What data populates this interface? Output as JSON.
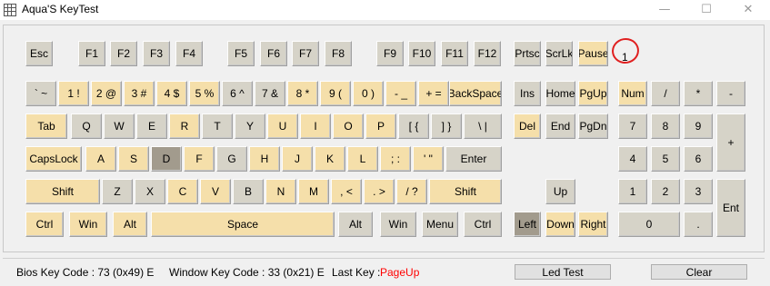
{
  "window": {
    "title": "Aqua'S KeyTest",
    "min_glyph": "—",
    "max_glyph": "☐",
    "close_glyph": "✕"
  },
  "keyboard": {
    "pressed_color": "#f5dfaa",
    "unpressed_color": "#d6d3c8",
    "current_color": "#a29b8d",
    "keys": [
      {
        "label": "Esc",
        "state": "gray"
      },
      {
        "label": "F1",
        "state": "gray"
      },
      {
        "label": "F2",
        "state": "gray"
      },
      {
        "label": "F3",
        "state": "gray"
      },
      {
        "label": "F4",
        "state": "gray"
      },
      {
        "label": "F5",
        "state": "gray"
      },
      {
        "label": "F6",
        "state": "gray"
      },
      {
        "label": "F7",
        "state": "gray"
      },
      {
        "label": "F8",
        "state": "gray"
      },
      {
        "label": "F9",
        "state": "gray"
      },
      {
        "label": "F10",
        "state": "gray"
      },
      {
        "label": "F11",
        "state": "gray"
      },
      {
        "label": "F12",
        "state": "gray"
      },
      {
        "label": "Prtsc",
        "state": "gray"
      },
      {
        "label": "ScrLk",
        "state": "gray"
      },
      {
        "label": "Pause",
        "state": "yellow"
      },
      {
        "label": "` ~",
        "state": "gray"
      },
      {
        "label": "1 !",
        "state": "yellow"
      },
      {
        "label": "2 @",
        "state": "yellow"
      },
      {
        "label": "3 #",
        "state": "yellow"
      },
      {
        "label": "4 $",
        "state": "yellow"
      },
      {
        "label": "5 %",
        "state": "yellow"
      },
      {
        "label": "6 ^",
        "state": "gray"
      },
      {
        "label": "7 &",
        "state": "gray"
      },
      {
        "label": "8 *",
        "state": "yellow"
      },
      {
        "label": "9 (",
        "state": "yellow"
      },
      {
        "label": "0 )",
        "state": "yellow"
      },
      {
        "label": "- _",
        "state": "yellow"
      },
      {
        "label": "+ =",
        "state": "yellow"
      },
      {
        "label": "BackSpace",
        "state": "yellow"
      },
      {
        "label": "Ins",
        "state": "gray"
      },
      {
        "label": "Home",
        "state": "gray"
      },
      {
        "label": "PgUp",
        "state": "yellow"
      },
      {
        "label": "Num",
        "state": "yellow"
      },
      {
        "label": "/",
        "state": "gray"
      },
      {
        "label": "*",
        "state": "gray"
      },
      {
        "label": "-",
        "state": "gray"
      },
      {
        "label": "Tab",
        "state": "yellow"
      },
      {
        "label": "Q",
        "state": "gray"
      },
      {
        "label": "W",
        "state": "gray"
      },
      {
        "label": "E",
        "state": "gray"
      },
      {
        "label": "R",
        "state": "yellow"
      },
      {
        "label": "T",
        "state": "gray"
      },
      {
        "label": "Y",
        "state": "gray"
      },
      {
        "label": "U",
        "state": "yellow"
      },
      {
        "label": "I",
        "state": "yellow"
      },
      {
        "label": "O",
        "state": "yellow"
      },
      {
        "label": "P",
        "state": "yellow"
      },
      {
        "label": "[ {",
        "state": "gray"
      },
      {
        "label": "] }",
        "state": "gray"
      },
      {
        "label": "\\ |",
        "state": "gray"
      },
      {
        "label": "Del",
        "state": "yellow"
      },
      {
        "label": "End",
        "state": "gray"
      },
      {
        "label": "PgDn",
        "state": "gray"
      },
      {
        "label": "7",
        "state": "gray"
      },
      {
        "label": "8",
        "state": "gray"
      },
      {
        "label": "9",
        "state": "gray"
      },
      {
        "label": "+",
        "state": "gray"
      },
      {
        "label": "CapsLock",
        "state": "yellow"
      },
      {
        "label": "A",
        "state": "yellow"
      },
      {
        "label": "S",
        "state": "yellow"
      },
      {
        "label": "D",
        "state": "dark"
      },
      {
        "label": "F",
        "state": "yellow"
      },
      {
        "label": "G",
        "state": "gray"
      },
      {
        "label": "H",
        "state": "yellow"
      },
      {
        "label": "J",
        "state": "yellow"
      },
      {
        "label": "K",
        "state": "yellow"
      },
      {
        "label": "L",
        "state": "yellow"
      },
      {
        "label": "; :",
        "state": "yellow"
      },
      {
        "label": "' \"",
        "state": "yellow"
      },
      {
        "label": "Enter",
        "state": "gray"
      },
      {
        "label": "4",
        "state": "gray"
      },
      {
        "label": "5",
        "state": "gray"
      },
      {
        "label": "6",
        "state": "gray"
      },
      {
        "label": "Shift",
        "state": "yellow"
      },
      {
        "label": "Z",
        "state": "gray"
      },
      {
        "label": "X",
        "state": "gray"
      },
      {
        "label": "C",
        "state": "yellow"
      },
      {
        "label": "V",
        "state": "yellow"
      },
      {
        "label": "B",
        "state": "gray"
      },
      {
        "label": "N",
        "state": "yellow"
      },
      {
        "label": "M",
        "state": "yellow"
      },
      {
        "label": ", <",
        "state": "yellow"
      },
      {
        "label": ". >",
        "state": "yellow"
      },
      {
        "label": "/ ?",
        "state": "yellow"
      },
      {
        "label": "Shift",
        "state": "yellow"
      },
      {
        "label": "Up",
        "state": "gray"
      },
      {
        "label": "1",
        "state": "gray"
      },
      {
        "label": "2",
        "state": "gray"
      },
      {
        "label": "3",
        "state": "gray"
      },
      {
        "label": "Ent",
        "state": "gray"
      },
      {
        "label": "Ctrl",
        "state": "yellow"
      },
      {
        "label": "Win",
        "state": "yellow"
      },
      {
        "label": "Alt",
        "state": "yellow"
      },
      {
        "label": "Space",
        "state": "yellow"
      },
      {
        "label": "Alt",
        "state": "gray"
      },
      {
        "label": "Win",
        "state": "gray"
      },
      {
        "label": "Menu",
        "state": "gray"
      },
      {
        "label": "Ctrl",
        "state": "gray"
      },
      {
        "label": "Left",
        "state": "dark"
      },
      {
        "label": "Down",
        "state": "yellow"
      },
      {
        "label": "Right",
        "state": "yellow"
      },
      {
        "label": "0",
        "state": "gray"
      },
      {
        "label": ".",
        "state": "gray"
      }
    ]
  },
  "annotation": {
    "mark_color": "#e02020",
    "digit": "1"
  },
  "status": {
    "bios_key_code": "Bios Key Code : 73 (0x49) E",
    "window_key_code": "Window Key Code : 33 (0x21) E",
    "last_key_label": "Last Key :",
    "last_key_value": "PageUp",
    "last_key_color": "#ff0000",
    "led_test_button": "Led Test",
    "clear_button": "Clear"
  }
}
